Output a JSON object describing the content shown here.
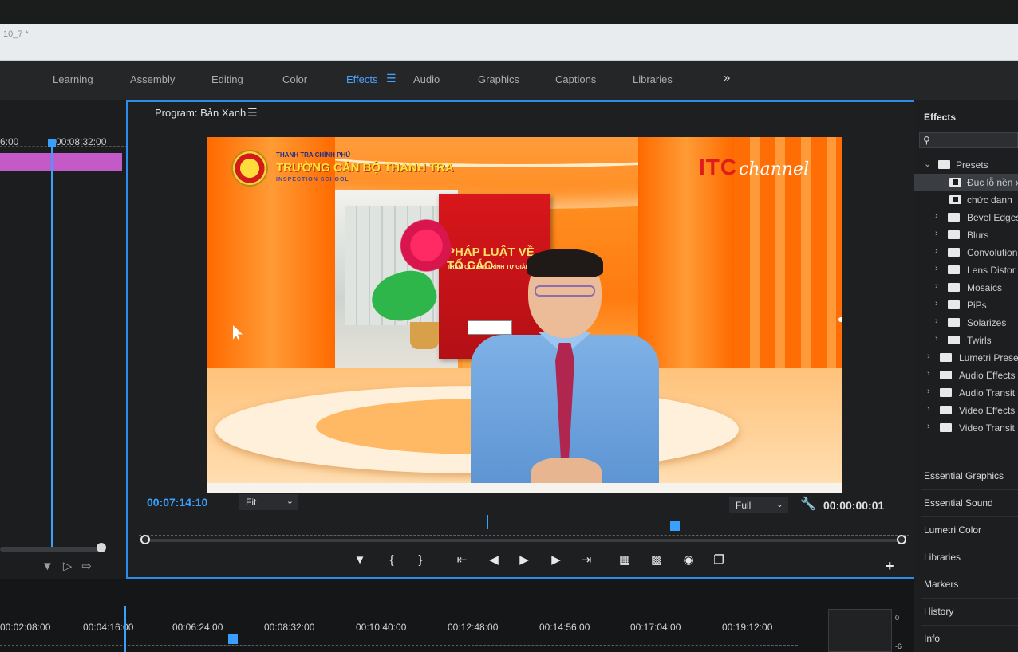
{
  "document": {
    "title": "10_7 *"
  },
  "workspaces": {
    "tabs": [
      {
        "label": "Learning"
      },
      {
        "label": "Assembly"
      },
      {
        "label": "Editing"
      },
      {
        "label": "Color"
      },
      {
        "label": "Effects",
        "active": true
      },
      {
        "label": "Audio"
      },
      {
        "label": "Graphics"
      },
      {
        "label": "Captions"
      },
      {
        "label": "Libraries"
      }
    ],
    "menu_icon": "hamburger-icon",
    "more_icon": "double-chevron-right-icon"
  },
  "timeline_left": {
    "ruler_labels": [
      "6:00",
      "00:08:32:00"
    ],
    "clip_color": "#c45ac8"
  },
  "program": {
    "title": "Program: Bản Xanh",
    "current_timecode": "00:07:14:10",
    "zoom_select": "Fit",
    "resolution_select": "Full",
    "duration_timecode": "00:00:00:01",
    "video": {
      "org_top": "THANH TRA CHÍNH PHỦ",
      "org_main": "TRƯỜNG CÁN BỘ THANH TRA",
      "org_sub": "INSPECTION SCHOOL",
      "channel_itc": "ITC",
      "channel_name": "channel",
      "book_title": "PHÁP LUẬT VỀ TỐ CÁO",
      "book_subtitle": "THẨM QUYỀN, TRÌNH TỰ GIẢI QUY"
    }
  },
  "transport_icons": [
    "add-marker-icon",
    "mark-in-icon",
    "mark-out-icon",
    "go-to-in-icon",
    "step-back-icon",
    "play-icon",
    "step-forward-icon",
    "go-to-out-icon",
    "lift-icon",
    "extract-icon",
    "export-frame-icon",
    "comparison-view-icon"
  ],
  "effects_panel": {
    "title": "Effects",
    "tree": [
      {
        "label": "Presets",
        "level": 0,
        "expanded": true,
        "type": "folder"
      },
      {
        "label": "Đục lỗ nền x",
        "level": 1,
        "type": "preset",
        "selected": true
      },
      {
        "label": "chức danh",
        "level": 1,
        "type": "preset"
      },
      {
        "label": "Bevel Edges",
        "level": 1,
        "type": "folder"
      },
      {
        "label": "Blurs",
        "level": 1,
        "type": "folder"
      },
      {
        "label": "Convolution",
        "level": 1,
        "type": "folder"
      },
      {
        "label": "Lens Distor",
        "level": 1,
        "type": "folder"
      },
      {
        "label": "Mosaics",
        "level": 1,
        "type": "folder"
      },
      {
        "label": "PiPs",
        "level": 1,
        "type": "folder"
      },
      {
        "label": "Solarizes",
        "level": 1,
        "type": "folder"
      },
      {
        "label": "Twirls",
        "level": 1,
        "type": "folder"
      },
      {
        "label": "Lumetri Prese",
        "level": 0,
        "type": "folder"
      },
      {
        "label": "Audio Effects",
        "level": 0,
        "type": "folder"
      },
      {
        "label": "Audio Transit",
        "level": 0,
        "type": "folder"
      },
      {
        "label": "Video Effects",
        "level": 0,
        "type": "folder"
      },
      {
        "label": "Video Transit",
        "level": 0,
        "type": "folder"
      }
    ],
    "sections": [
      "Essential Graphics",
      "Essential Sound",
      "Lumetri Color",
      "Libraries",
      "Markers",
      "History",
      "Info"
    ]
  },
  "timeline_bottom": {
    "ruler_labels": [
      "00:02:08:00",
      "00:04:16:00",
      "00:06:24:00",
      "00:08:32:00",
      "00:10:40:00",
      "00:12:48:00",
      "00:14:56:00",
      "00:17:04:00",
      "00:19:12:00"
    ],
    "meter_labels": [
      "0",
      "-6"
    ]
  },
  "colors": {
    "accent": "#2d8cf0",
    "clip": "#c45ac8"
  }
}
